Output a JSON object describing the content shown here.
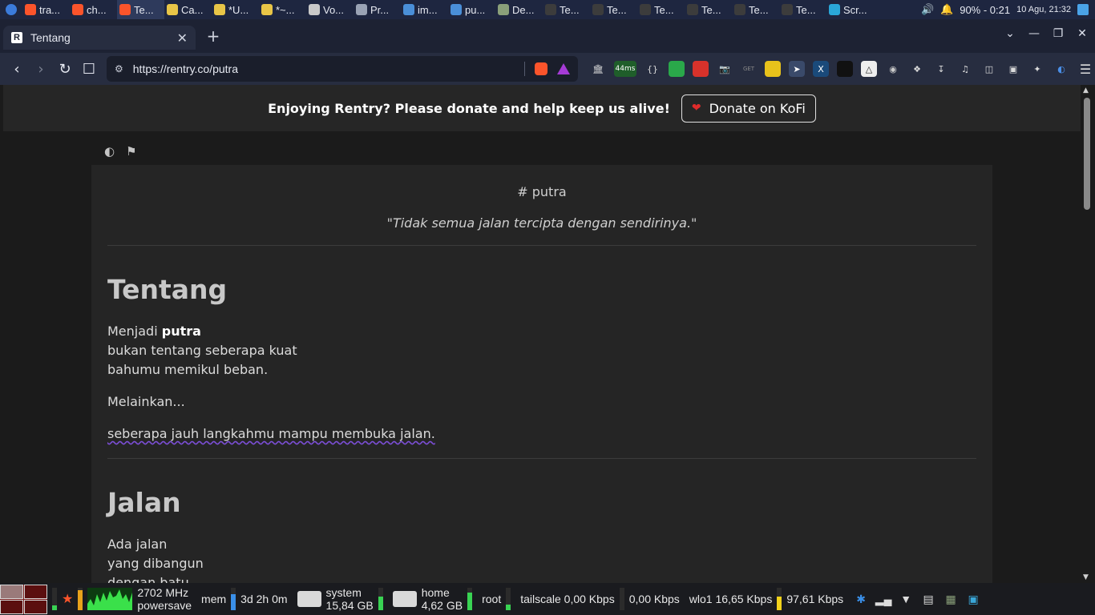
{
  "topbar": {
    "tasks": [
      {
        "label": "tra...",
        "icon": "brave-icon",
        "color": "#fb542b"
      },
      {
        "label": "ch...",
        "icon": "brave-icon",
        "color": "#fb542b"
      },
      {
        "label": "Te...",
        "icon": "brave-icon",
        "color": "#fb542b",
        "active": true
      },
      {
        "label": "Ca...",
        "icon": "notes-icon",
        "color": "#e8c547"
      },
      {
        "label": "*U...",
        "icon": "notes-icon",
        "color": "#e8c547"
      },
      {
        "label": "*~...",
        "icon": "notes-icon",
        "color": "#e8c547"
      },
      {
        "label": "Vo...",
        "icon": "app-icon",
        "color": "#c9c9c9"
      },
      {
        "label": "Pr...",
        "icon": "folder-icon",
        "color": "#9aa3b5"
      },
      {
        "label": "im...",
        "icon": "folder-icon",
        "color": "#4a8fd8"
      },
      {
        "label": "pu...",
        "icon": "folder-icon",
        "color": "#4a8fd8"
      },
      {
        "label": "De...",
        "icon": "app-icon",
        "color": "#8aa07a"
      },
      {
        "label": "Te...",
        "icon": "terminal-icon",
        "color": "#3c3c3c"
      },
      {
        "label": "Te...",
        "icon": "terminal-icon",
        "color": "#3c3c3c"
      },
      {
        "label": "Te...",
        "icon": "terminal-icon",
        "color": "#3c3c3c"
      },
      {
        "label": "Te...",
        "icon": "terminal-icon",
        "color": "#3c3c3c"
      },
      {
        "label": "Te...",
        "icon": "terminal-icon",
        "color": "#3c3c3c"
      },
      {
        "label": "Te...",
        "icon": "terminal-icon",
        "color": "#3c3c3c"
      },
      {
        "label": "Scr...",
        "icon": "screenshot-icon",
        "color": "#2aa7d8"
      }
    ],
    "battery": "90% - 0:21",
    "clock": "10 Agu, 21:32"
  },
  "browser": {
    "tab_title": "Tentang",
    "tab_favicon": "R",
    "url": "https://rentry.co/putra",
    "ping": "44ms"
  },
  "donate": {
    "text": "Enjoying Rentry? Please donate and help keep us alive!",
    "button": "Donate on KoFi"
  },
  "content": {
    "hash_title": "# putra",
    "quote": "\"Tidak semua jalan tercipta dengan sendirinya.\"",
    "section1_title": "Tentang",
    "s1_line1_pre": "Menjadi ",
    "s1_line1_bold": "putra",
    "s1_line2": "bukan tentang seberapa kuat",
    "s1_line3": "bahumu memikul beban.",
    "s1_para2": "Melainkan...",
    "s1_para3": "seberapa jauh langkahmu mampu membuka jalan.",
    "section2_title": "Jalan",
    "s2_line1": "Ada jalan",
    "s2_line2": "yang dibangun",
    "s2_line3": "dengan batu..."
  },
  "panel": {
    "cpu_freq": "2702 MHz",
    "cpu_gov": "powersave",
    "mem_label": "mem",
    "uptime": "3d 2h 0m",
    "system_label": "system",
    "system_size": "15,84 GB",
    "home_label": "home",
    "home_size": "4,62 GB",
    "root_label": "root",
    "tailscale": "tailscale 0,00 Kbps",
    "tailscale_up": "0,00 Kbps",
    "wlo1": "wlo1  16,65 Kbps",
    "wlo1_up": "97,61 Kbps"
  }
}
